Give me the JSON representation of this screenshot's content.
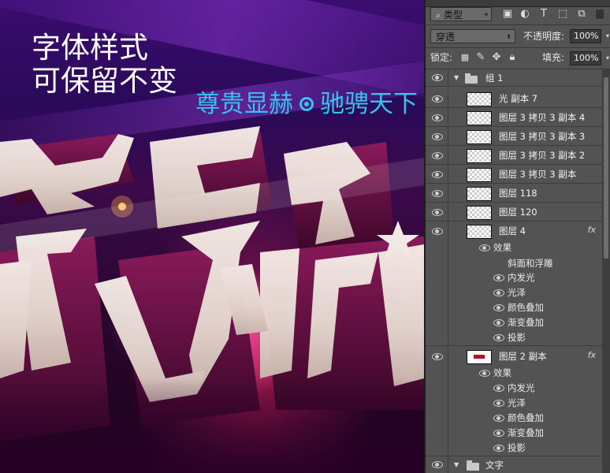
{
  "canvas": {
    "headline_line1": "字体样式",
    "headline_line2": "可保留不变",
    "tagline_left": "尊贵显赫",
    "tagline_right": "驰骋天下"
  },
  "panel": {
    "filter": {
      "label": "类型",
      "search_icon": "search-icon"
    },
    "filter_icons": [
      "image-filter-icon",
      "adjustment-filter-icon",
      "type-filter-icon",
      "shape-filter-icon",
      "smart-object-filter-icon"
    ],
    "blend_mode": "穿透",
    "opacity_label": "不透明度:",
    "opacity_value": "100%",
    "lock_label": "锁定:",
    "fill_label": "填充:",
    "fill_value": "100%",
    "layers": [
      {
        "name": "组 1",
        "type": "group"
      },
      {
        "name": "光 副本 7"
      },
      {
        "name": "图层 3 拷贝 3 副本 4"
      },
      {
        "name": "图层 3 拷贝 3 副本 3"
      },
      {
        "name": "图层 3 拷贝 3 副本 2"
      },
      {
        "name": "图层 3 拷贝 3 副本"
      },
      {
        "name": "图层 118"
      },
      {
        "name": "图层 120"
      },
      {
        "name": "图层 4",
        "fx": "fx"
      },
      {
        "name": "效果",
        "type": "effects-header"
      },
      {
        "name": "斜面和浮雕"
      },
      {
        "name": "内发光"
      },
      {
        "name": "光泽"
      },
      {
        "name": "颜色叠加"
      },
      {
        "name": "渐变叠加"
      },
      {
        "name": "投影"
      },
      {
        "name": "图层 2 副本",
        "fx": "fx"
      },
      {
        "name": "效果",
        "type": "effects-header"
      },
      {
        "name": "内发光"
      },
      {
        "name": "光泽"
      },
      {
        "name": "颜色叠加"
      },
      {
        "name": "渐变叠加"
      },
      {
        "name": "投影"
      },
      {
        "name": "文字",
        "type": "group"
      }
    ]
  }
}
